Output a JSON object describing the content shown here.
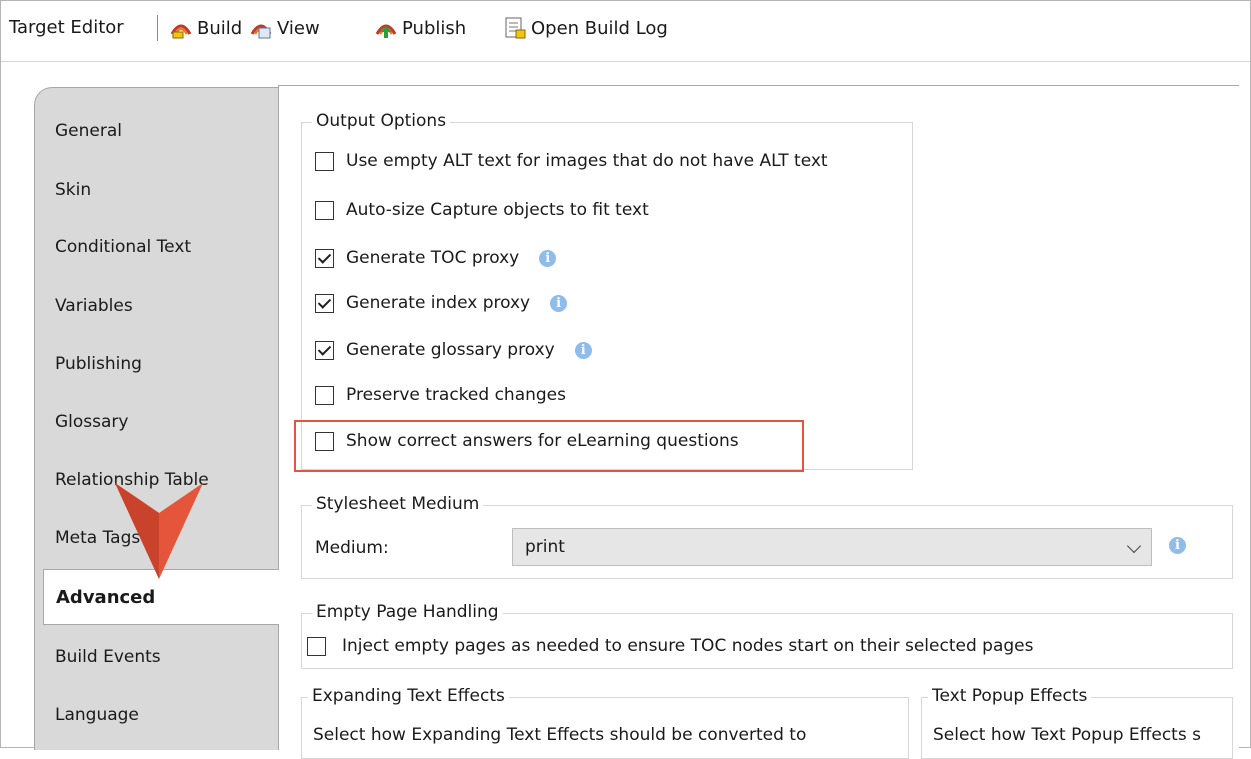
{
  "toolbar": {
    "title": "Target Editor",
    "buttons": [
      {
        "label": "Build",
        "icon": "build-icon"
      },
      {
        "label": "View",
        "icon": "view-icon"
      },
      {
        "label": "Publish",
        "icon": "publish-icon"
      },
      {
        "label": "Open Build Log",
        "icon": "build-log-icon"
      }
    ]
  },
  "tabs": [
    {
      "label": "General"
    },
    {
      "label": "Skin"
    },
    {
      "label": "Conditional Text"
    },
    {
      "label": "Variables"
    },
    {
      "label": "Publishing"
    },
    {
      "label": "Glossary"
    },
    {
      "label": "Relationship Table"
    },
    {
      "label": "Meta Tags"
    },
    {
      "label": "Advanced",
      "active": true
    },
    {
      "label": "Build Events"
    },
    {
      "label": "Language"
    }
  ],
  "output_options": {
    "legend": "Output Options",
    "items": [
      {
        "label": "Use empty ALT text for images that do not have ALT text",
        "checked": false
      },
      {
        "label": "Auto-size Capture objects to fit text",
        "checked": false
      },
      {
        "label": "Generate TOC proxy",
        "checked": true,
        "info": true
      },
      {
        "label": "Generate index proxy",
        "checked": true,
        "info": true
      },
      {
        "label": "Generate glossary proxy",
        "checked": true,
        "info": true
      },
      {
        "label": "Preserve tracked changes",
        "checked": false
      },
      {
        "label": "Show correct answers for eLearning questions",
        "checked": false
      }
    ]
  },
  "stylesheet_medium": {
    "legend": "Stylesheet Medium",
    "label": "Medium:",
    "value": "print"
  },
  "empty_page_handling": {
    "legend": "Empty Page Handling",
    "checkbox_label": "Inject empty pages as needed to ensure TOC nodes start on their selected pages",
    "checked": false
  },
  "expanding_text_effects": {
    "legend": "Expanding Text Effects",
    "description": "Select how Expanding Text Effects should be converted to"
  },
  "text_popup_effects": {
    "legend": "Text Popup Effects",
    "description": "Select how Text Popup Effects s"
  },
  "colors": {
    "highlight_border": "#e4553b",
    "annotation_arrow": "#e4553b",
    "info_icon": "#8fbcea",
    "tabstrip_bg": "#d9d9d9"
  }
}
